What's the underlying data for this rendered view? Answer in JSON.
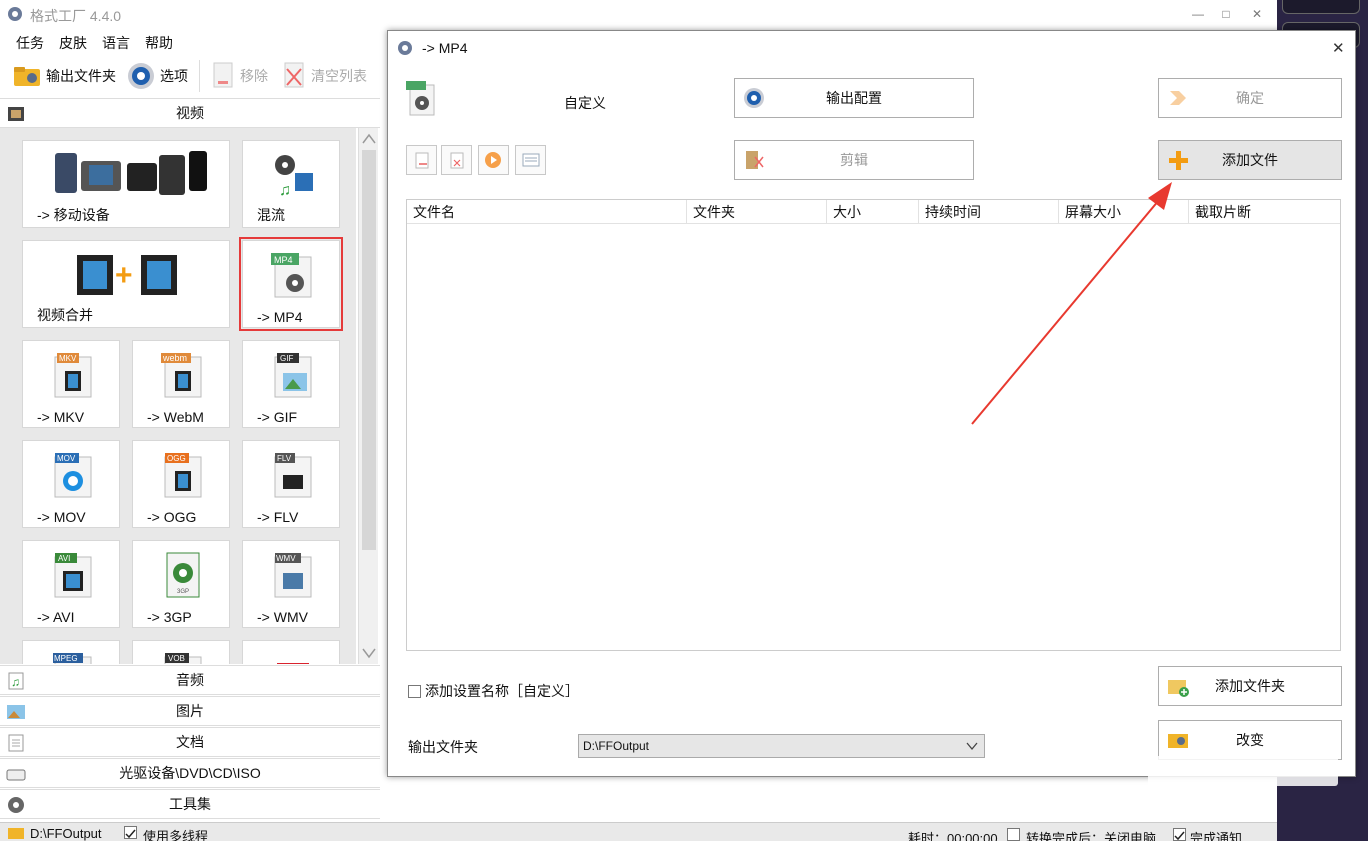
{
  "app": {
    "title": "格式工厂 4.4.0"
  },
  "menu": [
    "任务",
    "皮肤",
    "语言",
    "帮助"
  ],
  "toolbar": {
    "output_folder": "输出文件夹",
    "options": "选项",
    "remove": "移除",
    "clear_list": "清空列表"
  },
  "categories": {
    "video": "视频",
    "audio": "音频",
    "image": "图片",
    "document": "文档",
    "optical": "光驱设备\\DVD\\CD\\ISO",
    "tools": "工具集"
  },
  "tiles": {
    "mobile": "-> 移动设备",
    "mux": "混流",
    "merge": "视频合并",
    "mp4": "-> MP4",
    "mkv": "-> MKV",
    "webm": "-> WebM",
    "gif": "-> GIF",
    "mov": "-> MOV",
    "ogg": "-> OGG",
    "flv": "-> FLV",
    "avi": "-> AVI",
    "3gp": "-> 3GP",
    "wmv": "-> WMV"
  },
  "tile_badges": {
    "mp4": "MP4",
    "mkv": "MKV",
    "webm": "webm",
    "gif": "GIF",
    "mov": "MOV",
    "ogg": "OGG",
    "flv": "FLV",
    "avi": "AVI",
    "3gp": "3GP",
    "wmv": "WMV",
    "mpeg": "MPEG",
    "vob": "VOB"
  },
  "status": {
    "path": "D:\\FFOutput",
    "multithread": "使用多线程",
    "elapsed": "耗时：00:00:00",
    "after_done": "转换完成后：关闭电脑",
    "notify": "完成通知"
  },
  "dialog": {
    "title": "-> MP4",
    "profile": "自定义",
    "output_config": "输出配置",
    "ok": "确定",
    "clip": "剪辑",
    "add_file": "添加文件",
    "columns": [
      "文件名",
      "文件夹",
      "大小",
      "持续时间",
      "屏幕大小",
      "截取片断"
    ],
    "add_setting_name": "添加设置名称［自定义］",
    "add_folder": "添加文件夹",
    "output_folder_label": "输出文件夹",
    "output_folder_value": "D:\\FFOutput",
    "change": "改变"
  },
  "colors": {
    "accent_red": "#e53a3a",
    "arrow": "#e8392f",
    "orange": "#f39c12"
  }
}
